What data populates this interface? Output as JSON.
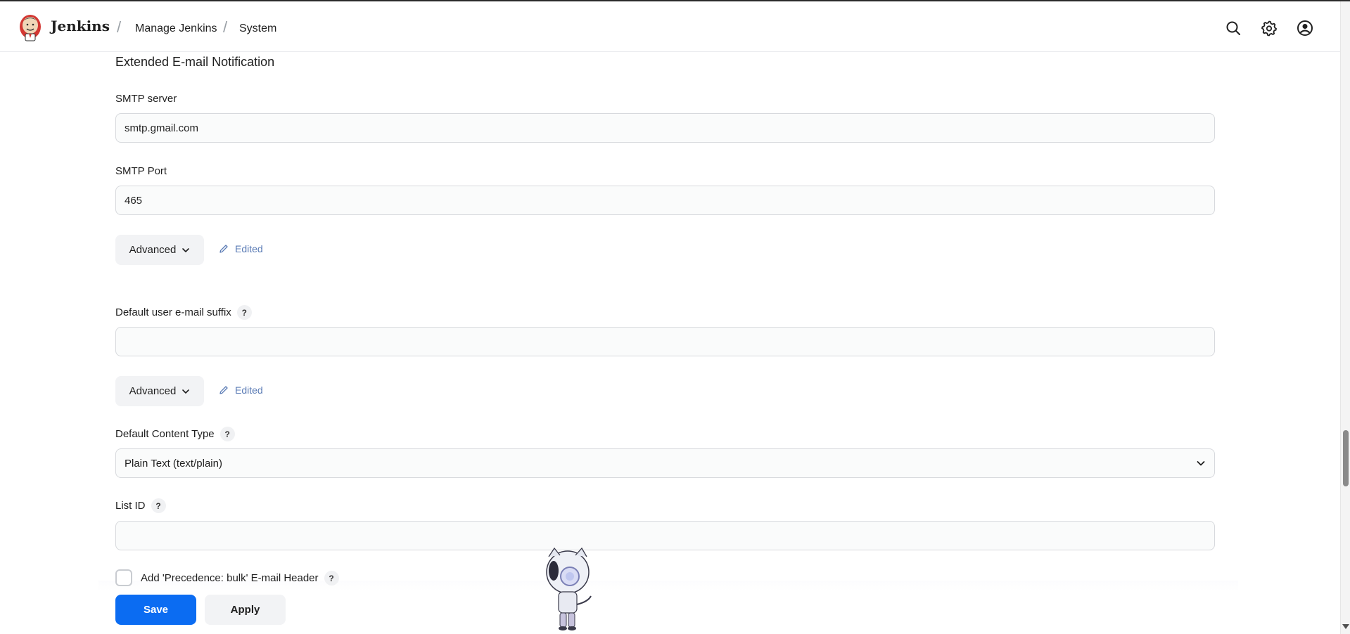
{
  "header": {
    "brand": "Jenkins",
    "breadcrumbs": [
      "Manage Jenkins",
      "System"
    ],
    "icons": [
      "search-icon",
      "gear-icon",
      "user-account-icon"
    ]
  },
  "section": {
    "title": "Extended E-mail Notification"
  },
  "fields": {
    "smtp_server": {
      "label": "SMTP server",
      "value": "smtp.gmail.com"
    },
    "smtp_port": {
      "label": "SMTP Port",
      "value": "465"
    },
    "advanced_1": {
      "label": "Advanced",
      "edited": "Edited"
    },
    "default_suffix": {
      "label": "Default user e-mail suffix",
      "help": "?",
      "value": ""
    },
    "advanced_2": {
      "label": "Advanced",
      "edited": "Edited"
    },
    "content_type": {
      "label": "Default Content Type",
      "help": "?",
      "selected": "Plain Text (text/plain)"
    },
    "list_id": {
      "label": "List ID",
      "help": "?",
      "value": ""
    },
    "precedence": {
      "label": "Add 'Precedence: bulk' E-mail Header",
      "help": "?",
      "checked": false
    }
  },
  "actions": {
    "save": "Save",
    "apply": "Apply"
  },
  "colors": {
    "primary": "#0b6cf2",
    "edited_link": "#5a7bb5"
  }
}
